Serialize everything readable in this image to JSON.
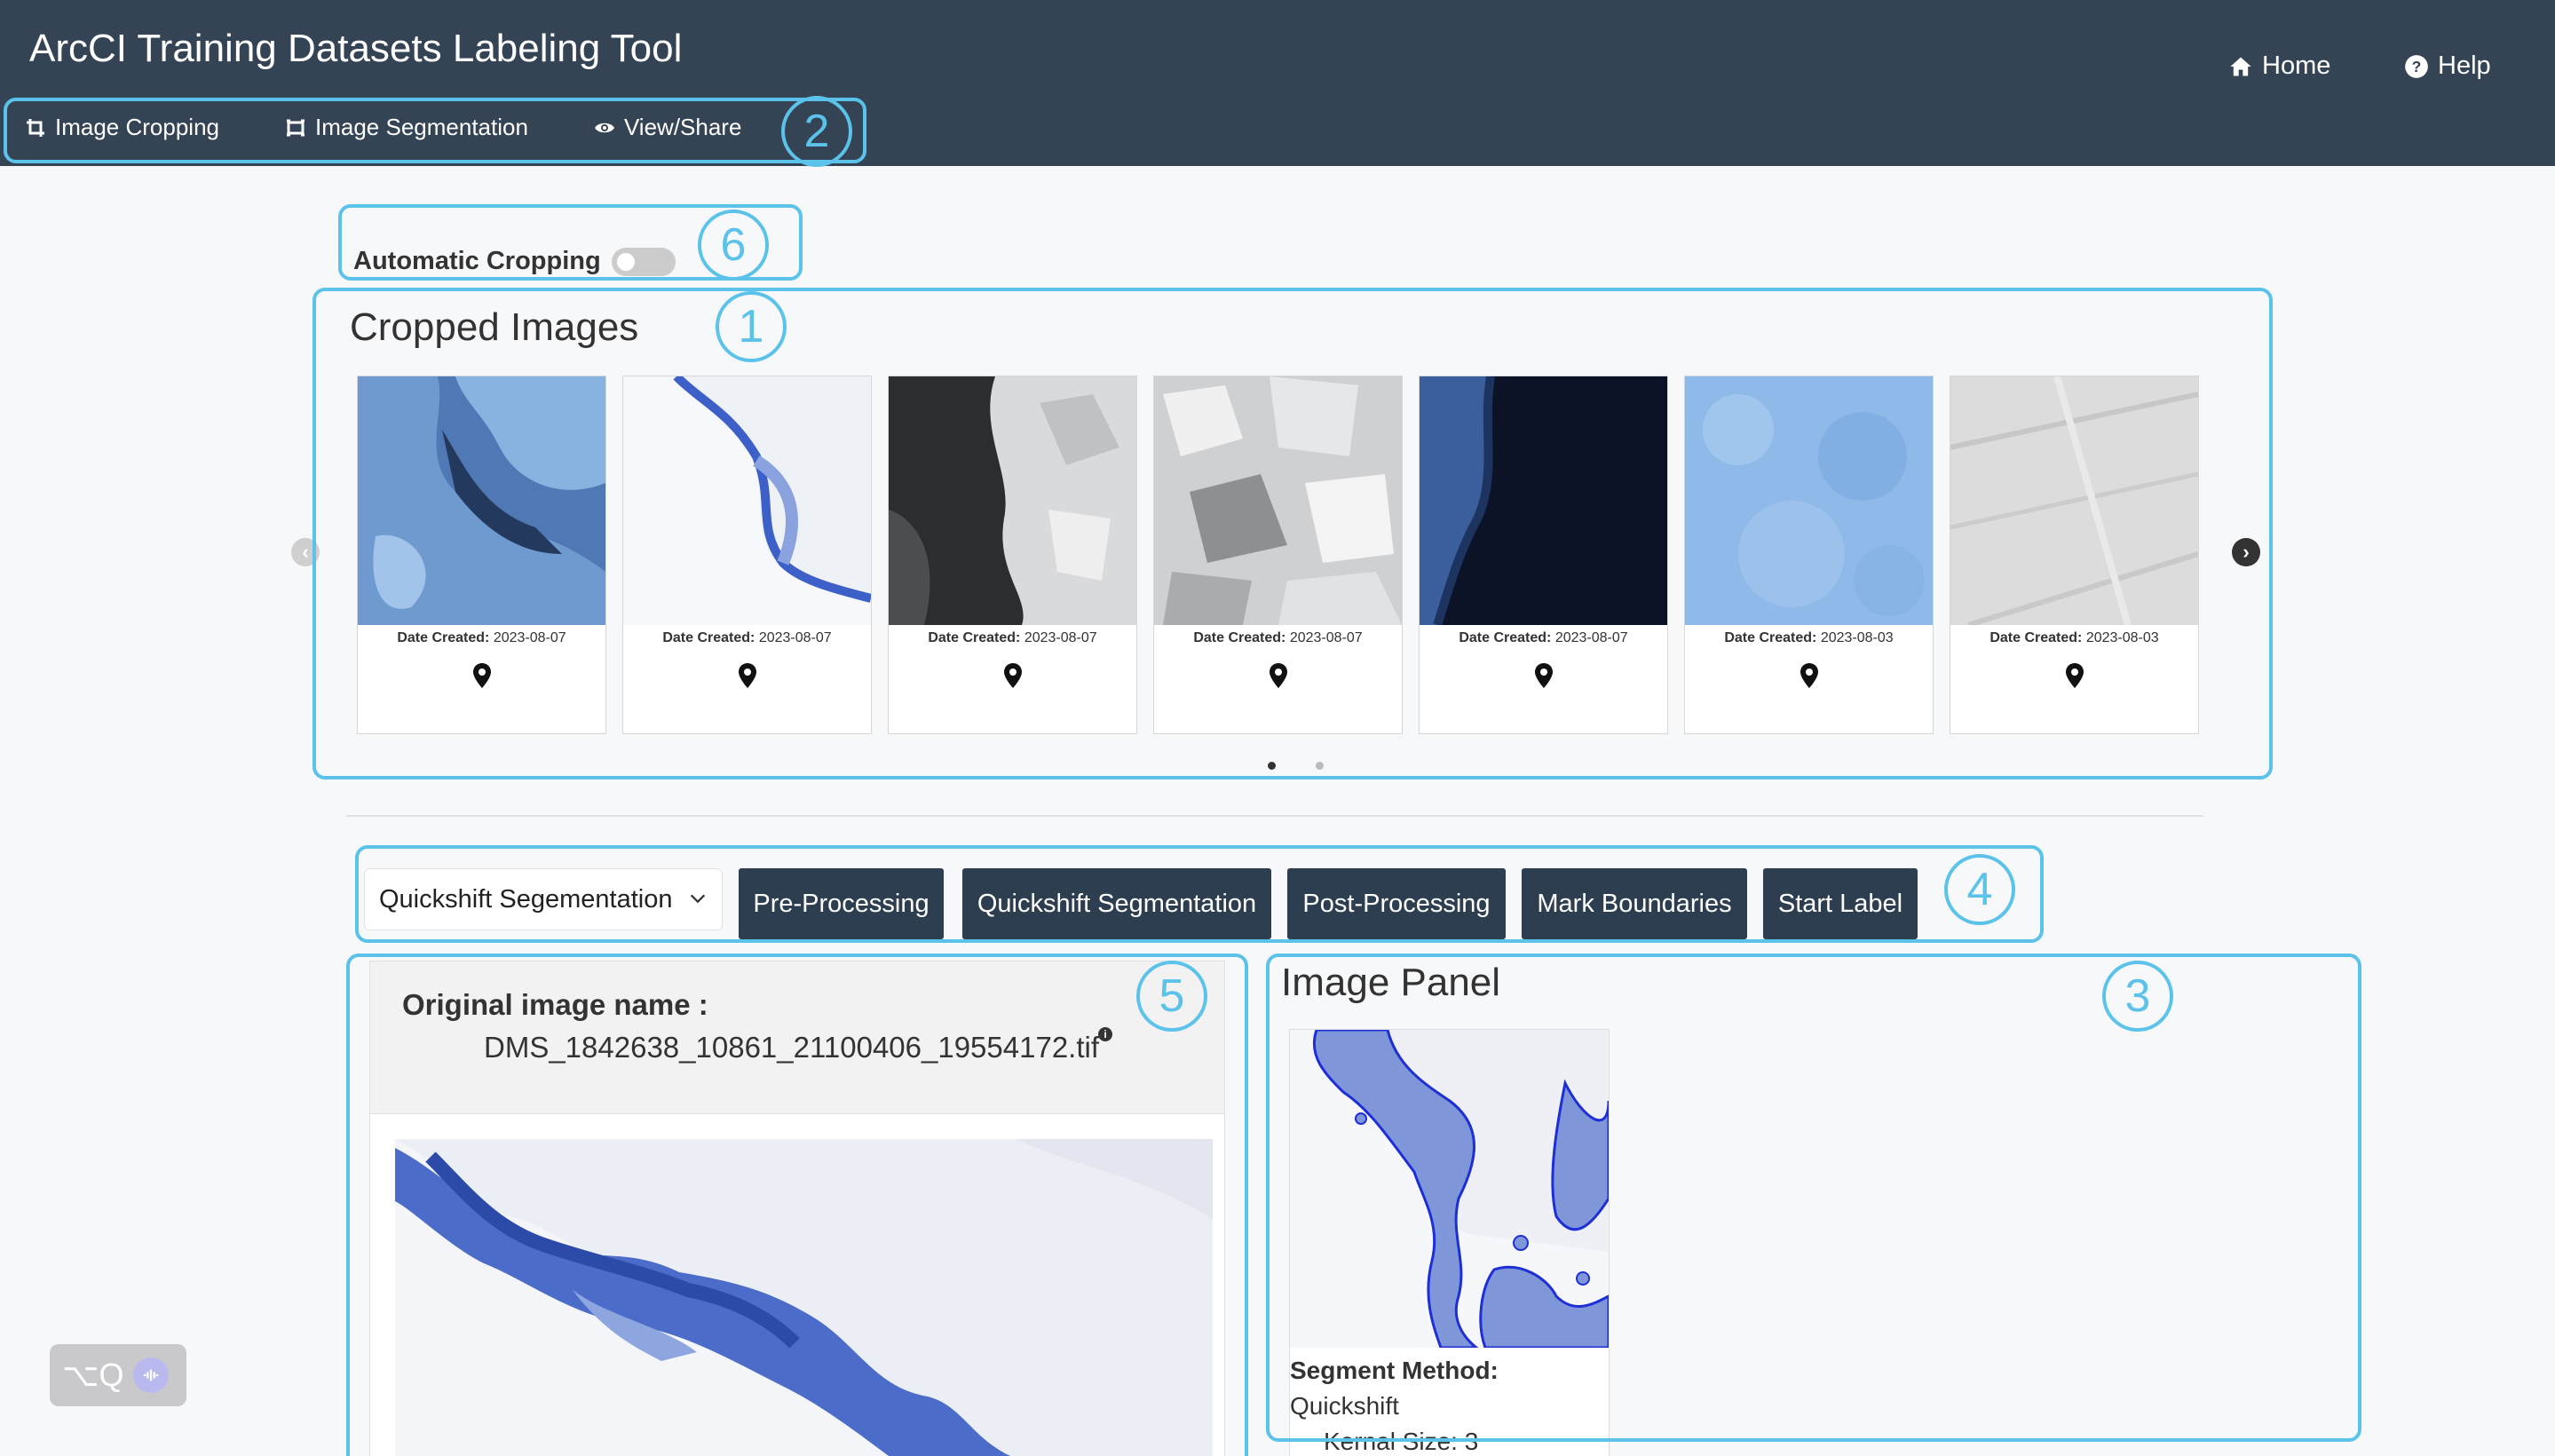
{
  "header": {
    "title": "ArcCI Training Datasets Labeling Tool",
    "home_label": "Home",
    "help_label": "Help",
    "tabs": [
      {
        "label": "Image Cropping",
        "icon": "crop-icon"
      },
      {
        "label": "Image Segmentation",
        "icon": "segment-icon"
      },
      {
        "label": "View/Share",
        "icon": "eye-icon"
      }
    ]
  },
  "auto_cropping": {
    "label": "Automatic Cropping",
    "enabled": false
  },
  "cropped_images": {
    "title": "Cropped Images",
    "date_label": "Date Created:",
    "items": [
      {
        "date": "2023-08-07"
      },
      {
        "date": "2023-08-07"
      },
      {
        "date": "2023-08-07"
      },
      {
        "date": "2023-08-07"
      },
      {
        "date": "2023-08-07"
      },
      {
        "date": "2023-08-03"
      },
      {
        "date": "2023-08-03"
      }
    ],
    "page_count": 2,
    "active_page": 1
  },
  "segmentation_toolbar": {
    "selected_method": "Quickshift Segementation",
    "buttons": [
      "Pre-Processing",
      "Quickshift Segmentation",
      "Post-Processing",
      "Mark Boundaries",
      "Start Label"
    ]
  },
  "original_image": {
    "label": "Original image name :",
    "filename": "DMS_1842638_10861_21100406_19554172.tif"
  },
  "image_panel": {
    "title": "Image Panel",
    "segment_method_label": "Segment Method:",
    "segment_method_value": "Quickshift",
    "kernel_size": "Kernal Size: 3"
  },
  "annotations": {
    "cropped_images_badge": "1",
    "tabs_badge": "2",
    "image_panel_badge": "3",
    "toolbar_badge": "4",
    "original_image_badge": "5",
    "auto_cropping_badge": "6"
  },
  "widget": {
    "label": "⌥Q"
  },
  "colors": {
    "header": "#344455",
    "button": "#2c3e50",
    "annotation": "#5bc2ea",
    "segment_outline": "#1f2fd6"
  }
}
